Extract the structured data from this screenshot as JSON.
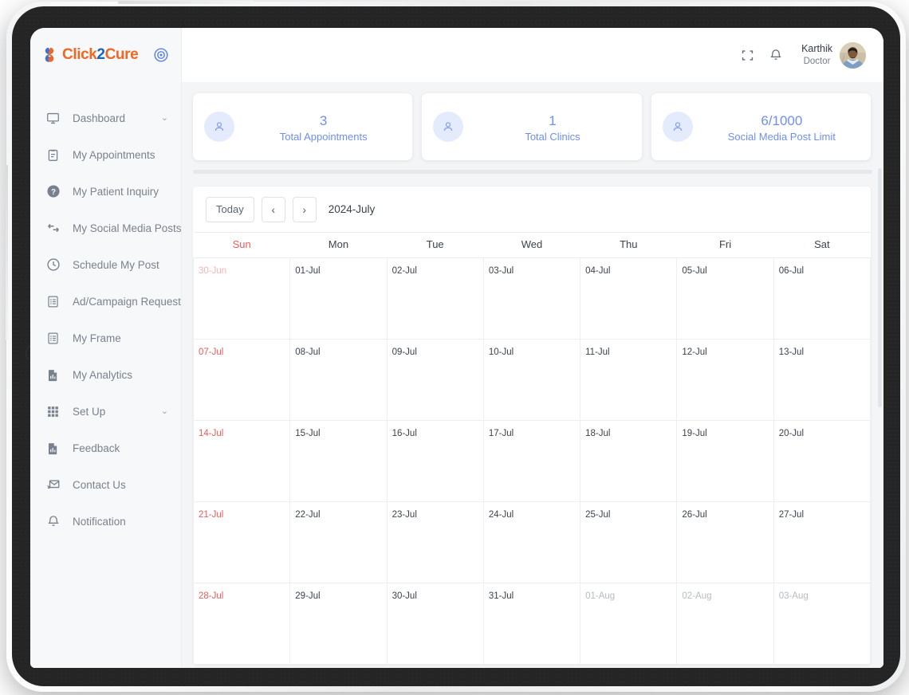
{
  "brand": {
    "name_part1": "Click",
    "name_part2": "2",
    "name_part3": "Cure",
    "logo_icon": "click2cure-cross-icon",
    "target_icon": "target-circle-icon",
    "color_orange": "#ef6723",
    "color_blue": "#1565c0"
  },
  "sidebar": {
    "items": [
      {
        "label": "Dashboard",
        "icon": "monitor-icon",
        "caret": "⌄",
        "has_caret": true
      },
      {
        "label": "My Appointments",
        "icon": "clipboard-icon",
        "caret": "",
        "has_caret": false
      },
      {
        "label": "My Patient Inquiry",
        "icon": "question-circle-icon",
        "caret": "",
        "has_caret": false
      },
      {
        "label": "My Social Media Posts",
        "icon": "repeat-arrows-icon",
        "caret": "",
        "has_caret": false
      },
      {
        "label": "Schedule My Post",
        "icon": "clock-icon",
        "caret": "",
        "has_caret": false
      },
      {
        "label": "Ad/Campaign Request",
        "icon": "list-document-icon",
        "caret": "",
        "has_caret": false
      },
      {
        "label": "My Frame",
        "icon": "list-document-icon",
        "caret": "",
        "has_caret": false
      },
      {
        "label": "My Analytics",
        "icon": "chart-document-icon",
        "caret": "",
        "has_caret": false
      },
      {
        "label": "Set Up",
        "icon": "grid-apps-icon",
        "caret": "⌄",
        "has_caret": true
      },
      {
        "label": "Feedback",
        "icon": "chart-document-icon",
        "caret": "",
        "has_caret": false
      },
      {
        "label": "Contact Us",
        "icon": "mail-send-icon",
        "caret": "",
        "has_caret": false
      },
      {
        "label": "Notification",
        "icon": "bell-icon",
        "caret": "",
        "has_caret": false
      }
    ]
  },
  "topbar": {
    "fullscreen_icon": "fullscreen-expand-icon",
    "bell_icon": "bell-icon",
    "user_name": "Karthik",
    "user_role": "Doctor",
    "avatar_icon": "user-avatar-photo"
  },
  "stat_cards": [
    {
      "value": "3",
      "label": "Total Appointments",
      "icon": "person-icon"
    },
    {
      "value": "1",
      "label": "Total Clinics",
      "icon": "person-icon"
    },
    {
      "value": "6/1000",
      "label": "Social Media Post Limit",
      "icon": "person-icon"
    }
  ],
  "calendar": {
    "today_label": "Today",
    "prev_label": "‹",
    "next_label": "›",
    "title": "2024-July",
    "weekdays": [
      "Sun",
      "Mon",
      "Tue",
      "Wed",
      "Thu",
      "Fri",
      "Sat"
    ],
    "weeks": [
      [
        {
          "text": "30-Jun",
          "other": true,
          "sunday": true
        },
        {
          "text": "01-Jul",
          "other": false,
          "sunday": false
        },
        {
          "text": "02-Jul",
          "other": false,
          "sunday": false
        },
        {
          "text": "03-Jul",
          "other": false,
          "sunday": false
        },
        {
          "text": "04-Jul",
          "other": false,
          "sunday": false
        },
        {
          "text": "05-Jul",
          "other": false,
          "sunday": false
        },
        {
          "text": "06-Jul",
          "other": false,
          "sunday": false
        }
      ],
      [
        {
          "text": "07-Jul",
          "other": false,
          "sunday": true
        },
        {
          "text": "08-Jul",
          "other": false,
          "sunday": false
        },
        {
          "text": "09-Jul",
          "other": false,
          "sunday": false
        },
        {
          "text": "10-Jul",
          "other": false,
          "sunday": false
        },
        {
          "text": "11-Jul",
          "other": false,
          "sunday": false
        },
        {
          "text": "12-Jul",
          "other": false,
          "sunday": false
        },
        {
          "text": "13-Jul",
          "other": false,
          "sunday": false
        }
      ],
      [
        {
          "text": "14-Jul",
          "other": false,
          "sunday": true
        },
        {
          "text": "15-Jul",
          "other": false,
          "sunday": false
        },
        {
          "text": "16-Jul",
          "other": false,
          "sunday": false
        },
        {
          "text": "17-Jul",
          "other": false,
          "sunday": false
        },
        {
          "text": "18-Jul",
          "other": false,
          "sunday": false
        },
        {
          "text": "19-Jul",
          "other": false,
          "sunday": false
        },
        {
          "text": "20-Jul",
          "other": false,
          "sunday": false
        }
      ],
      [
        {
          "text": "21-Jul",
          "other": false,
          "sunday": true
        },
        {
          "text": "22-Jul",
          "other": false,
          "sunday": false
        },
        {
          "text": "23-Jul",
          "other": false,
          "sunday": false
        },
        {
          "text": "24-Jul",
          "other": false,
          "sunday": false
        },
        {
          "text": "25-Jul",
          "other": false,
          "sunday": false
        },
        {
          "text": "26-Jul",
          "other": false,
          "sunday": false
        },
        {
          "text": "27-Jul",
          "other": false,
          "sunday": false
        }
      ],
      [
        {
          "text": "28-Jul",
          "other": false,
          "sunday": true
        },
        {
          "text": "29-Jul",
          "other": false,
          "sunday": false
        },
        {
          "text": "30-Jul",
          "other": false,
          "sunday": false
        },
        {
          "text": "31-Jul",
          "other": false,
          "sunday": false
        },
        {
          "text": "01-Aug",
          "other": true,
          "sunday": false
        },
        {
          "text": "02-Aug",
          "other": true,
          "sunday": false
        },
        {
          "text": "03-Aug",
          "other": true,
          "sunday": false
        }
      ]
    ]
  }
}
